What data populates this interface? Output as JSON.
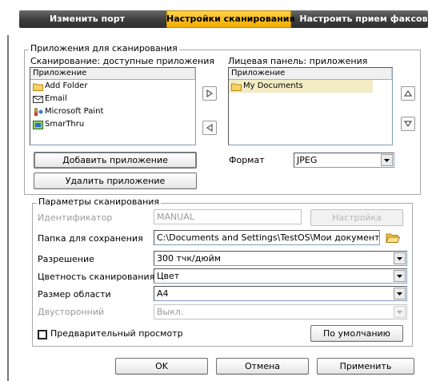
{
  "tabs": [
    "Изменить порт",
    "Настройки сканирования",
    "Настроить прием факсов"
  ],
  "apps_group": {
    "legend": "Приложения для сканирования",
    "left_label": "Сканирование: доступные приложения",
    "right_label": "Лицевая панель: приложения",
    "column_header": "Приложение",
    "available": [
      {
        "name": "Add Folder",
        "icon": "folder-icon"
      },
      {
        "name": "Email",
        "icon": "email-icon"
      },
      {
        "name": "Microsoft Paint",
        "icon": "paint-icon"
      },
      {
        "name": "SmarThru",
        "icon": "smarthru-icon"
      }
    ],
    "front_panel": [
      {
        "name": "My Documents",
        "icon": "folder-icon"
      }
    ],
    "add_button": "Добавить приложение",
    "remove_button": "Удалить приложение",
    "format_label": "Формат",
    "format_value": "JPEG"
  },
  "scan_group": {
    "legend": "Параметры сканирования",
    "id_label": "Идентификатор",
    "id_value": "MANUAL",
    "settings_button": "Настройка",
    "folder_label": "Папка для сохранения",
    "folder_value": "C:\\Documents and Settings\\TestOS\\Мои документы\\М",
    "resolution_label": "Разрешение",
    "resolution_value": "300 тчк/дюйм",
    "color_label": "Цветность сканирования",
    "color_value": "Цвет",
    "size_label": "Размер области",
    "size_value": "A4",
    "duplex_label": "Двусторонний",
    "duplex_value": "Выкл.",
    "preview_label": "Предварительный просмотр",
    "defaults_button": "По умолчанию"
  },
  "footer": {
    "ok": "OK",
    "cancel": "Отмена",
    "apply": "Применить"
  },
  "colors": {
    "active_tab": "#f3a900",
    "tab_bar": "#3c3c3c",
    "selection": "#f3ecc4",
    "folder": "#f0c24a"
  }
}
